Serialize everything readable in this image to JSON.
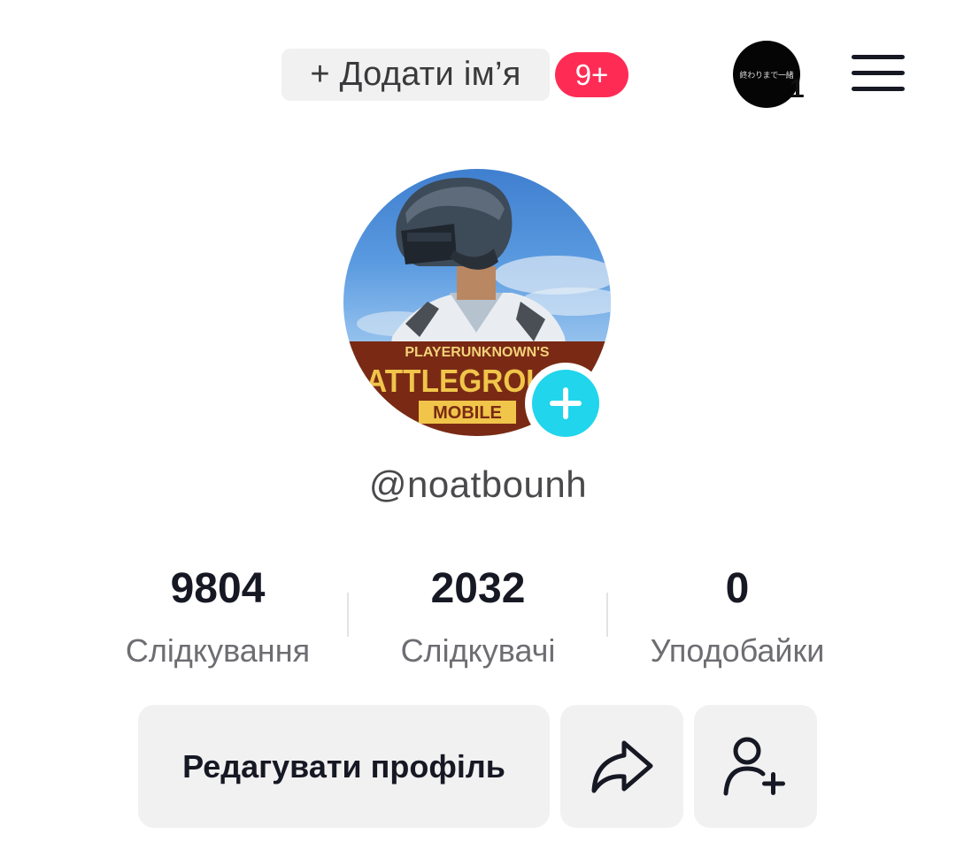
{
  "header": {
    "add_name_label": "+ Додати ім’я",
    "notification_badge": "9+",
    "story_avatar_text": "終わりまで一緒",
    "story_count": "1",
    "menu_icon": "hamburger-menu-icon"
  },
  "profile": {
    "avatar_image": "PUBG Mobile soldier in helmet",
    "avatar_logo_text_top": "PLAYERUNKNOWN'S",
    "avatar_logo_text_main": "BATTLEGROUNDS",
    "avatar_logo_text_bottom": "MOBILE",
    "add_photo_icon": "plus-icon",
    "username": "@noatbounh"
  },
  "stats": [
    {
      "value": "9804",
      "label": "Слідкування"
    },
    {
      "value": "2032",
      "label": "Слідкувачі"
    },
    {
      "value": "0",
      "label": "Уподобайки"
    }
  ],
  "actions": {
    "edit_profile_label": "Редагувати профіль",
    "share_icon": "share-arrow-icon",
    "add_friend_icon": "add-friend-icon"
  },
  "colors": {
    "badge": "#fe2c55",
    "add_photo": "#20d5ec",
    "button_bg": "#f1f1f2",
    "text_primary": "#161823",
    "text_secondary": "#6d6d72"
  }
}
